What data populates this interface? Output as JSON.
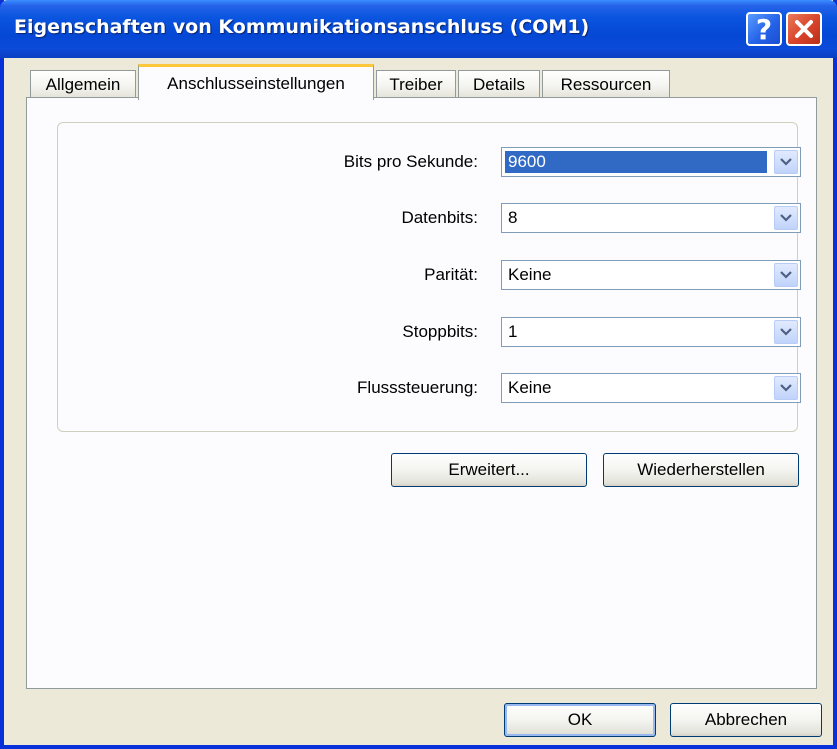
{
  "window": {
    "title": "Eigenschaften von Kommunikationsanschluss (COM1)"
  },
  "titlebar": {
    "help_glyph": "?",
    "icons": [
      "help-icon",
      "close-icon"
    ]
  },
  "tabs": [
    {
      "label": "Allgemein",
      "active": false
    },
    {
      "label": "Anschlusseinstellungen",
      "active": true
    },
    {
      "label": "Treiber",
      "active": false
    },
    {
      "label": "Details",
      "active": false
    },
    {
      "label": "Ressourcen",
      "active": false
    }
  ],
  "settings": {
    "bits_per_second": {
      "label": "Bits pro Sekunde:",
      "value": "9600"
    },
    "data_bits": {
      "label": "Datenbits:",
      "value": "8"
    },
    "parity": {
      "label": "Parität:",
      "value": "Keine"
    },
    "stop_bits": {
      "label": "Stoppbits:",
      "value": "1"
    },
    "flow_control": {
      "label": "Flusssteuerung:",
      "value": "Keine"
    }
  },
  "actions": {
    "advanced": "Erweitert...",
    "restore": "Wiederherstellen"
  },
  "footer": {
    "ok": "OK",
    "cancel": "Abbrechen"
  },
  "colors": {
    "titlebar": "#0548D6",
    "selection": "#316AC5",
    "close": "#D8432A",
    "tab_highlight": "#FFC83C",
    "face": "#ECE9D8"
  }
}
